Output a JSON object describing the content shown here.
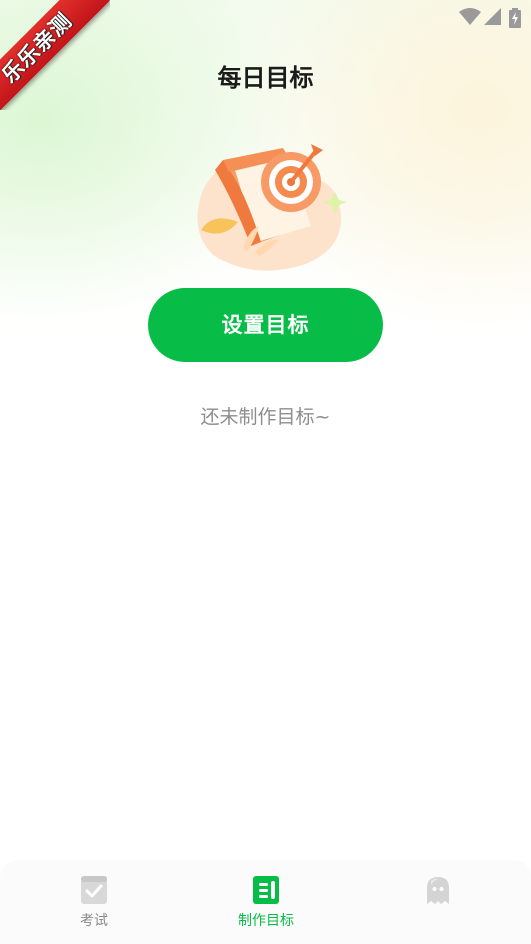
{
  "ribbon": {
    "text": "乐乐亲测"
  },
  "header": {
    "title": "每日目标"
  },
  "main": {
    "set_goal_button": "设置目标",
    "empty_message": "还未制作目标~"
  },
  "bottom_nav": {
    "items": [
      {
        "label": "考试",
        "icon": "exam-checklist-icon",
        "active": false
      },
      {
        "label": "制作目标",
        "icon": "goal-document-icon",
        "active": true
      },
      {
        "label": "",
        "icon": "ghost-avatar-icon",
        "active": false
      }
    ]
  },
  "colors": {
    "accent": "#08bd47",
    "title": "#1b1b1b",
    "muted_text": "#8e8e8e",
    "ribbon": "#d11f23"
  }
}
